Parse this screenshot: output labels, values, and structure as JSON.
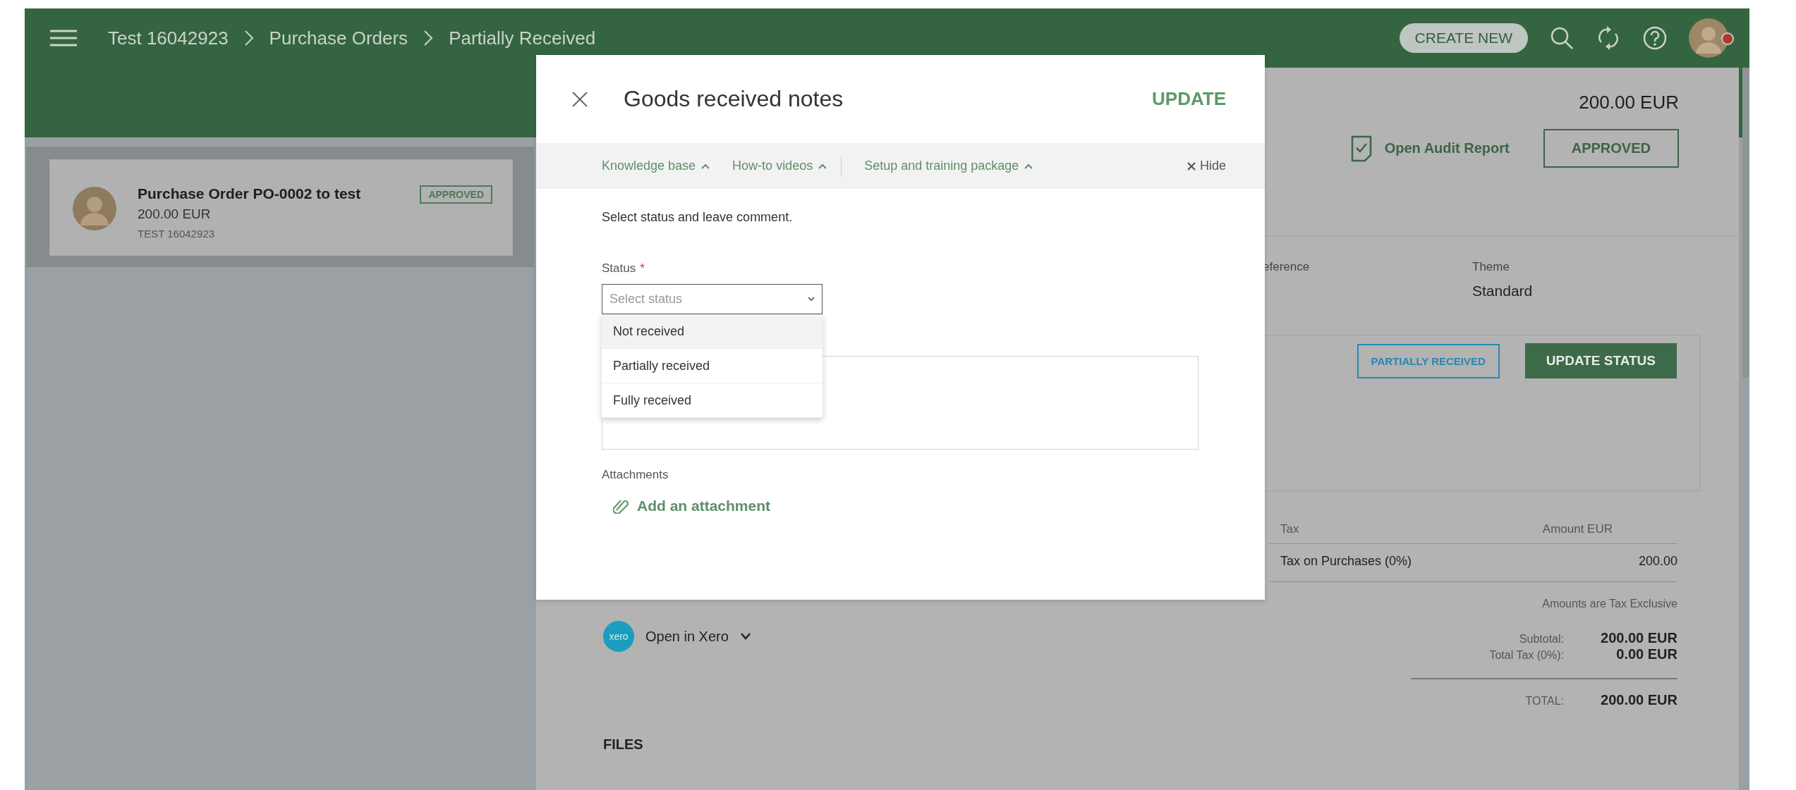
{
  "header": {
    "breadcrumbs": [
      "Test 16042923",
      "Purchase Orders",
      "Partially Received"
    ],
    "create_button": "CREATE NEW",
    "avatar_notification": true
  },
  "sidebar": {
    "cards": [
      {
        "title": "Purchase Order PO-0002 to test",
        "amount": "200.00 EUR",
        "company": "TEST 16042923",
        "badge": "APPROVED"
      }
    ]
  },
  "document": {
    "total": "200.00 EUR",
    "audit_link": "Open Audit Report",
    "status_button": "APPROVED",
    "fields": [
      {
        "label": "eference"
      },
      {
        "label": "Theme",
        "value": "Standard"
      }
    ],
    "receipt_status": {
      "badge": "PARTIALLY RECEIVED",
      "button": "UPDATE STATUS"
    },
    "tax_table": {
      "columns": [
        "Tax",
        "Amount EUR"
      ],
      "rows": [
        [
          "Tax on Purchases (0%)",
          "200.00"
        ]
      ]
    },
    "note": "Amounts are Tax Exclusive",
    "totals": [
      {
        "label": "Subtotal:",
        "value": "200.00 EUR",
        "kind": "sub"
      },
      {
        "label": "Total Tax (0%):",
        "value": "0.00 EUR",
        "kind": "sub"
      },
      {
        "label": "TOTAL:",
        "value": "200.00 EUR",
        "kind": "grand"
      }
    ],
    "xero_logo": "xero",
    "xero_link": "Open in Xero",
    "files_heading": "FILES"
  },
  "modal": {
    "title": "Goods received notes",
    "action": "UPDATE",
    "help_links": [
      {
        "label": "Knowledge base"
      },
      {
        "label": "How-to videos"
      },
      {
        "label": "Setup and training package"
      }
    ],
    "hide": "Hide",
    "instruction": "Select status and leave comment.",
    "status_field": {
      "label": "Status",
      "required_mark": "*",
      "placeholder": "Select status",
      "options": [
        {
          "label": "Not received",
          "highlighted": true
        },
        {
          "label": "Partially received",
          "highlighted": false
        },
        {
          "label": "Fully received",
          "highlighted": false
        }
      ]
    },
    "attachments_label": "Attachments",
    "attach_link": "Add an attachment"
  }
}
